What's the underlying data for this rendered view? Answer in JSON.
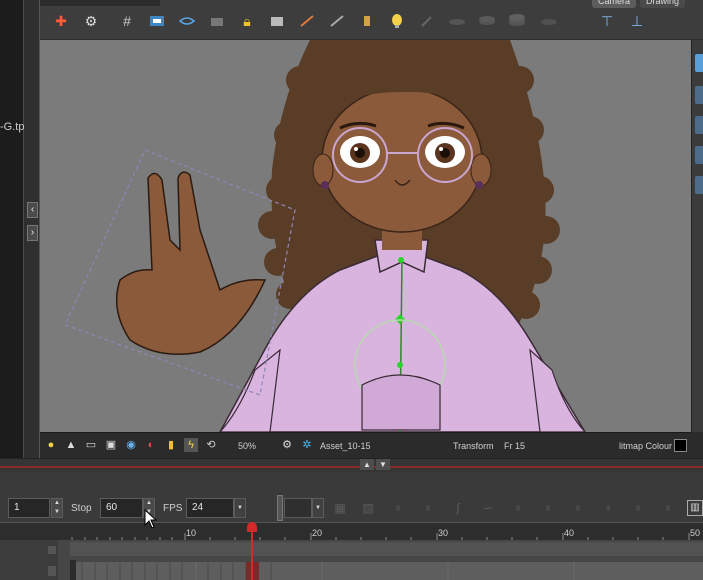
{
  "left_panel": {
    "file_label": "-G.tp"
  },
  "tabs": {
    "camera": "Camera",
    "drawing": "Drawing"
  },
  "status": {
    "zoom": "50%",
    "asset": "Asset_10-15",
    "mode": "Transform",
    "frame": "Fr 15",
    "color_mode": "litmap Colour"
  },
  "timeline": {
    "start_frame": "1",
    "stop_label": "Stop",
    "stop_value": "60",
    "fps_label": "FPS",
    "fps_value": "24",
    "ruler_labels": [
      "10",
      "20",
      "30",
      "40",
      "50"
    ]
  },
  "colors": {
    "skin": "#8a5a3b",
    "hoodie": "#d8b4df",
    "hair": "#5a3d26",
    "playhead": "#d42a2a",
    "viewport_bg": "#7b7b7b"
  }
}
